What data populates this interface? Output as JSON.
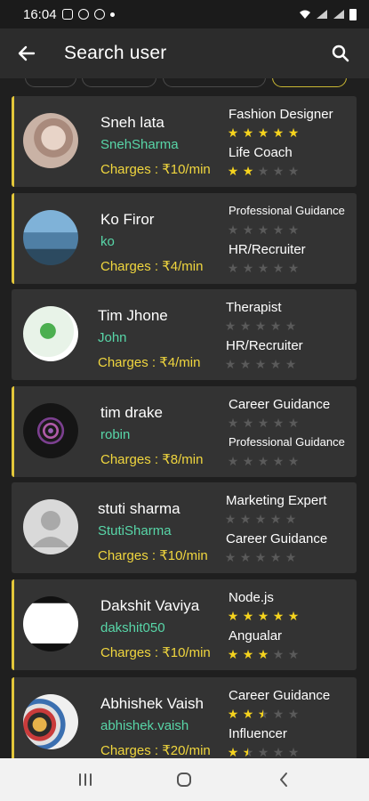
{
  "status_bar": {
    "time": "16:04"
  },
  "app_bar": {
    "title": "Search user"
  },
  "users": [
    {
      "name": "Sneh lata",
      "username": "SnehSharma",
      "charges": "Charges : ₹10/min",
      "skills": [
        {
          "label": "Fashion Designer",
          "rating": 5
        },
        {
          "label": "Life Coach",
          "rating": 2
        }
      ]
    },
    {
      "name": "Ko Firor",
      "username": "ko",
      "charges": "Charges : ₹4/min",
      "skills": [
        {
          "label": "Professional Guidance",
          "rating": 0
        },
        {
          "label": "HR/Recruiter",
          "rating": 0
        }
      ]
    },
    {
      "name": "Tim Jhone",
      "username": "John",
      "charges": "Charges : ₹4/min",
      "skills": [
        {
          "label": "Therapist",
          "rating": 0
        },
        {
          "label": "HR/Recruiter",
          "rating": 0
        }
      ]
    },
    {
      "name": "tim drake",
      "username": "robin",
      "charges": "Charges : ₹8/min",
      "skills": [
        {
          "label": "Career Guidance",
          "rating": 0
        },
        {
          "label": "Professional Guidance",
          "rating": 0
        }
      ]
    },
    {
      "name": "stuti sharma",
      "username": "StutiSharma",
      "charges": "Charges : ₹10/min",
      "skills": [
        {
          "label": "Marketing Expert",
          "rating": 0
        },
        {
          "label": "Career Guidance",
          "rating": 0
        }
      ]
    },
    {
      "name": "Dakshit Vaviya",
      "username": "dakshit050",
      "charges": "Charges : ₹10/min",
      "skills": [
        {
          "label": "Node.js",
          "rating": 5
        },
        {
          "label": "Angualar",
          "rating": 3
        }
      ]
    },
    {
      "name": "Abhishek Vaish",
      "username": "abhishek.vaish",
      "charges": "Charges : ₹20/min",
      "skills": [
        {
          "label": "Career Guidance",
          "rating": 2.5
        },
        {
          "label": "Influencer",
          "rating": 1.5
        }
      ]
    }
  ],
  "colors": {
    "accent": "#e2c63a",
    "card": "#333333",
    "username": "#58d6a8",
    "charges": "#f0d63e",
    "star_on": "#f5d31e",
    "star_off": "#5a5a5a"
  },
  "icons": {
    "back": "arrow-left-icon",
    "search": "search-icon",
    "nav_recents": "recents-icon",
    "nav_home": "home-icon",
    "nav_back": "chevron-left-icon"
  }
}
